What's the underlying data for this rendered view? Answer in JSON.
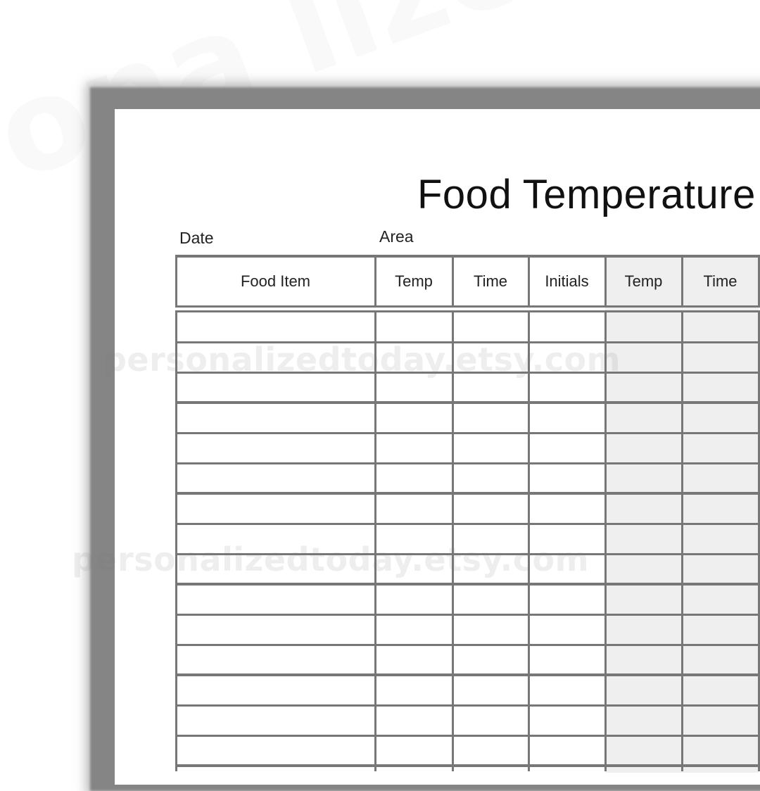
{
  "document": {
    "title": "Food Temperature",
    "fields": {
      "date_label": "Date",
      "area_label": "Area"
    },
    "table": {
      "columns": [
        {
          "label": "Food Item",
          "shaded": false
        },
        {
          "label": "Temp",
          "shaded": false
        },
        {
          "label": "Time",
          "shaded": false
        },
        {
          "label": "Initials",
          "shaded": false
        },
        {
          "label": "Temp",
          "shaded": true
        },
        {
          "label": "Time",
          "shaded": true
        }
      ],
      "visible_empty_rows": 15,
      "group_size": 3
    },
    "colors": {
      "frame": "#858585",
      "grid_line": "#777777",
      "shaded_column": "#efefef",
      "text": "#222222"
    }
  },
  "watermark": {
    "text_1": "personalizedtoday.etsy.com",
    "text_2": "personalizedtoday.etsy.com"
  }
}
